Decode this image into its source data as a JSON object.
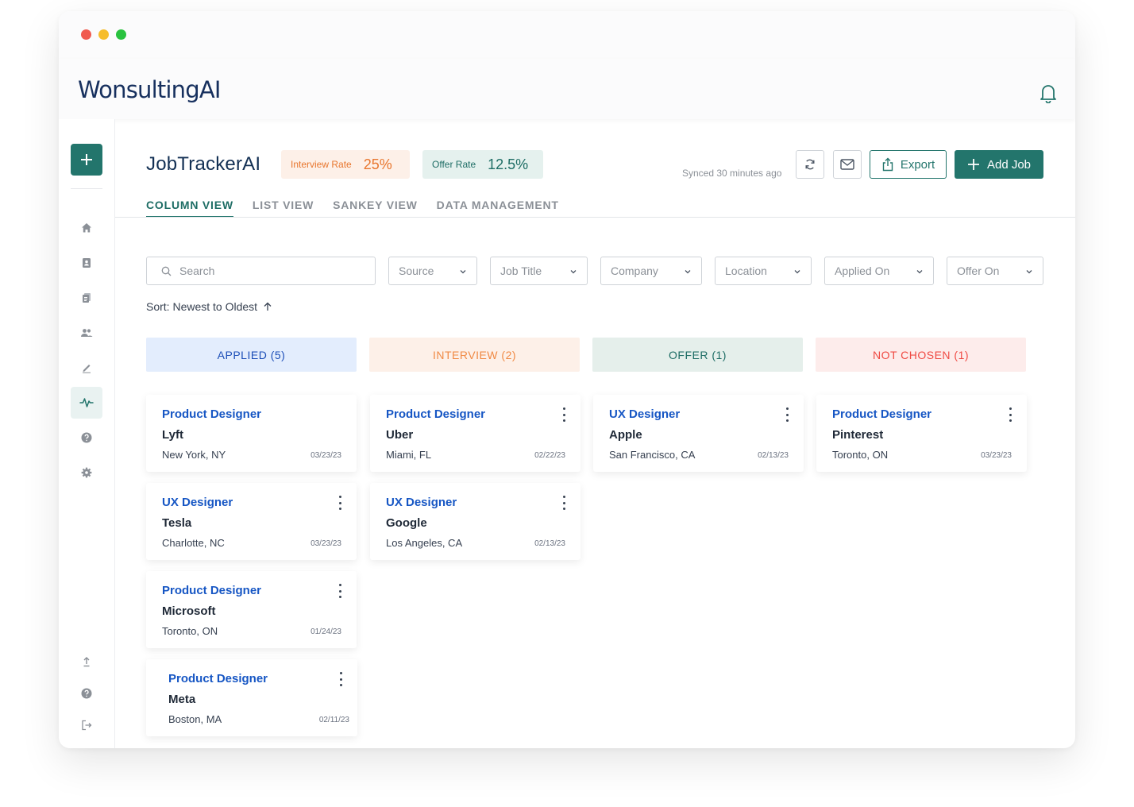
{
  "app": {
    "logo_text": "WonsultingAI",
    "page_title": "JobTrackerAI",
    "stats": {
      "interview_label": "Interview Rate",
      "interview_value": "25%",
      "offer_label": "Offer Rate",
      "offer_value": "12.5%"
    },
    "synced_text": "Synced 30 minutes ago",
    "export_label": "Export",
    "add_job_label": "Add Job"
  },
  "tabs": [
    "COLUMN VIEW",
    "LIST VIEW",
    "SANKEY VIEW",
    "DATA MANAGEMENT"
  ],
  "filters": {
    "search_placeholder": "Search",
    "source": "Source",
    "job_title": "Job Title",
    "company": "Company",
    "location": "Location",
    "applied_on": "Applied On",
    "offer_on": "Offer On"
  },
  "sort_label": "Sort: Newest to Oldest",
  "columns": [
    {
      "label": "APPLIED (5)",
      "bg": "#e3edfd",
      "color": "#1d4fb8",
      "cards": [
        {
          "title": "Product Designer",
          "company": "Lyft",
          "location": "New York, NY",
          "date": "03/23/23"
        },
        {
          "title": "UX Designer",
          "company": "Tesla",
          "location": "Charlotte, NC",
          "date": "03/23/23"
        },
        {
          "title": "Product Designer",
          "company": "Microsoft",
          "location": "Toronto, ON",
          "date": "01/24/23"
        },
        {
          "title": "Product Designer",
          "company": "Meta",
          "location": "Boston, MA",
          "date": "02/11/23"
        }
      ]
    },
    {
      "label": "INTERVIEW (2)",
      "bg": "#fdf0e8",
      "color": "#f08a45",
      "cards": [
        {
          "title": "Product Designer",
          "company": "Uber",
          "location": "Miami, FL",
          "date": "02/22/23"
        },
        {
          "title": "UX Designer",
          "company": "Google",
          "location": "Los Angeles, CA",
          "date": "02/13/23"
        }
      ]
    },
    {
      "label": "OFFER (1)",
      "bg": "#e5efeb",
      "color": "#1e6d65",
      "cards": [
        {
          "title": "UX Designer",
          "company": "Apple",
          "location": "San Francisco, CA",
          "date": "02/13/23"
        }
      ]
    },
    {
      "label": "NOT CHOSEN (1)",
      "bg": "#fdeceb",
      "color": "#ef4a43",
      "cards": [
        {
          "title": "Product Designer",
          "company": "Pinterest",
          "location": "Toronto, ON",
          "date": "03/23/23"
        }
      ]
    }
  ],
  "sidebar_icons": [
    "add-icon",
    "home-icon",
    "contacts-icon",
    "resume-icon",
    "people-icon",
    "pen-icon",
    "activity-icon",
    "help-icon",
    "settings-icon",
    "upload-icon",
    "help-icon",
    "logout-icon"
  ],
  "colors": {
    "brand": "#23756c",
    "link": "#1656c4",
    "title": "#133054"
  }
}
